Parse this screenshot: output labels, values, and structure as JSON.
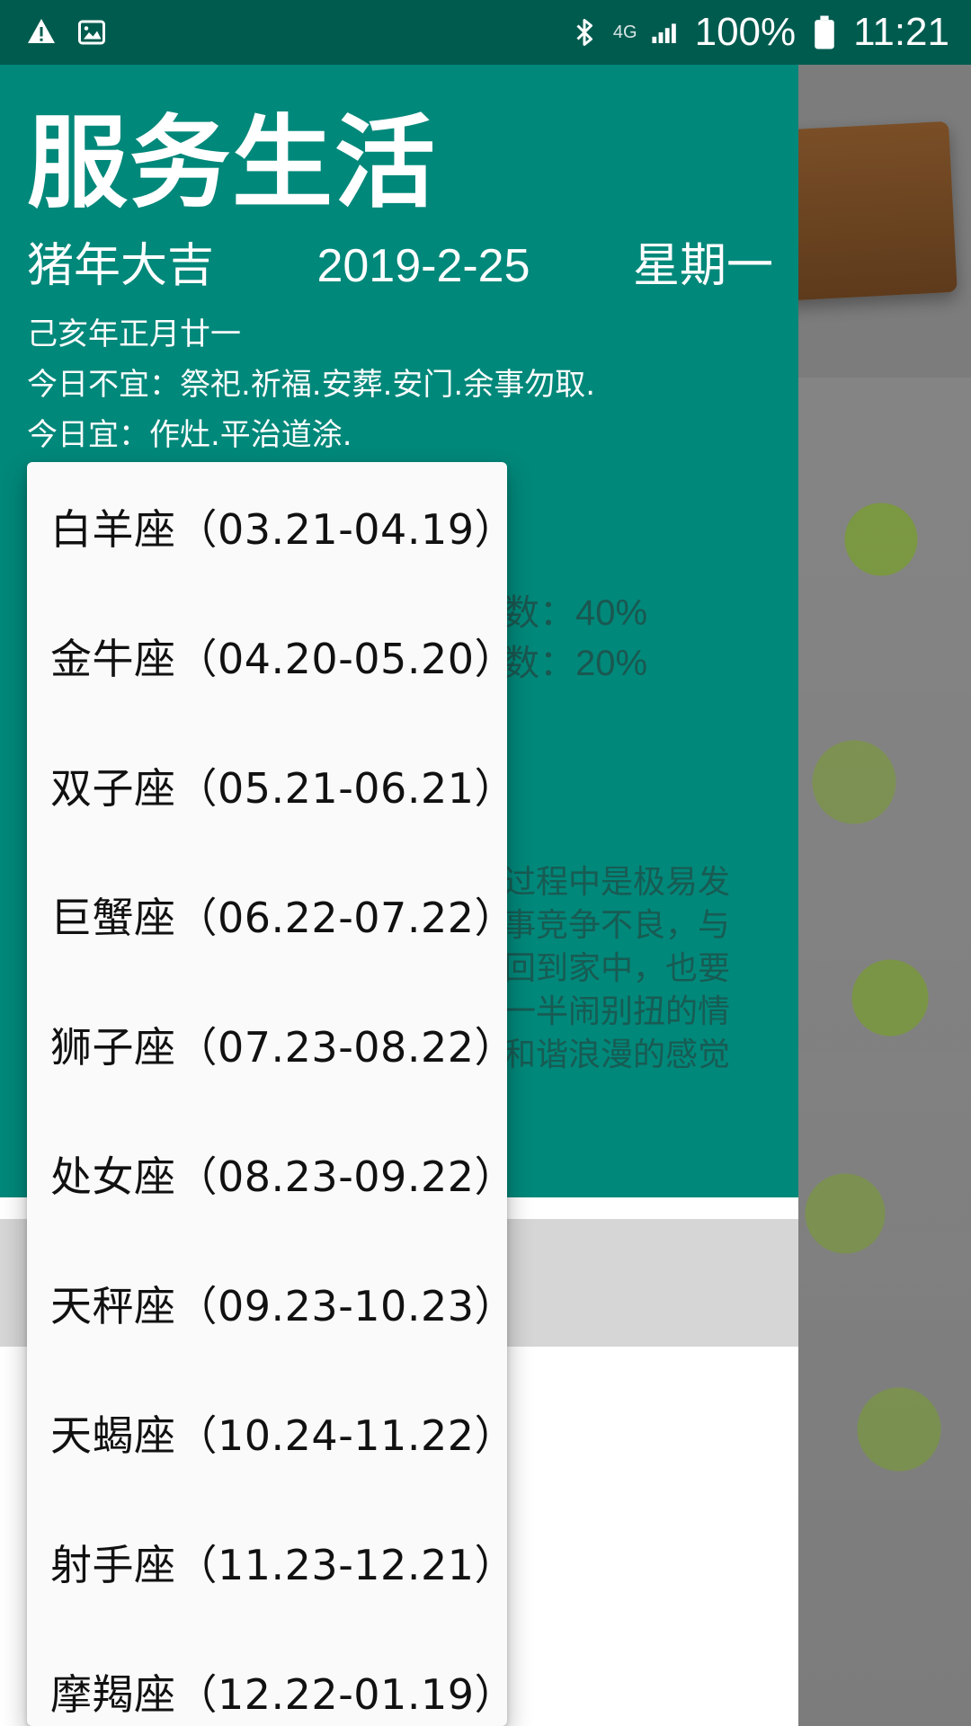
{
  "status_bar": {
    "left_icons": [
      "warning-icon",
      "image-icon"
    ],
    "network_label": "4G",
    "battery_percent": "100%",
    "time": "11:21",
    "right_icons": [
      "bluetooth-icon",
      "signal-icon",
      "battery-icon"
    ]
  },
  "header": {
    "title": "服务生活",
    "year_blessing": "猪年大吉",
    "date": "2019-2-25",
    "weekday": "星期一",
    "lunar_date": "己亥年正月廿一",
    "avoid": "今日不宜：祭祀.祈福.安葬.安门.余事勿取.",
    "suitable": "今日宜：作灶.平治道涂."
  },
  "background_text": {
    "luck_1": "数：40%",
    "luck_2": "数：20%",
    "description": "过程中是极易发\n事竞争不良，与\n回到家中，也要\n一半闹别扭的情\n和谐浪漫的感觉"
  },
  "dropdown": {
    "items": [
      "白羊座（03.21-04.19）",
      "金牛座（04.20-05.20）",
      "双子座（05.21-06.21）",
      "巨蟹座（06.22-07.22）",
      "狮子座（07.23-08.22）",
      "处女座（08.23-09.22）",
      "天秤座（09.23-10.23）",
      "天蝎座（10.24-11.22）",
      "射手座（11.23-12.21）",
      "摩羯座（12.22-01.19）"
    ]
  }
}
